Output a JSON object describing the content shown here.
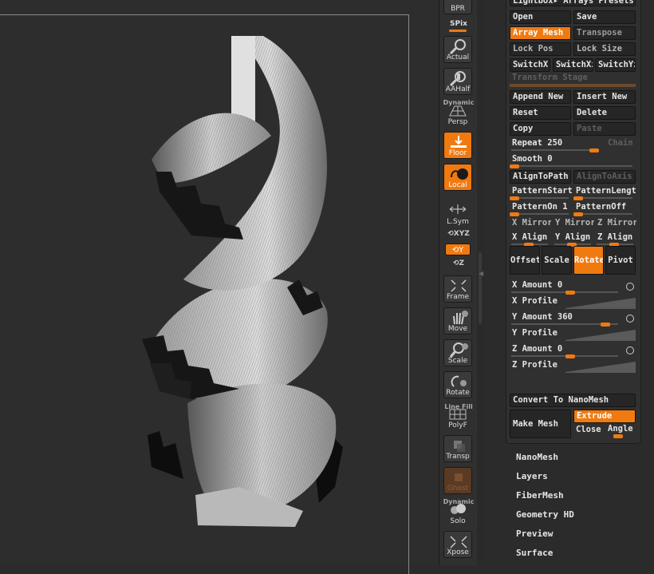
{
  "shelf": {
    "bpr": "BPR",
    "spix": "SPix",
    "actual": "Actual",
    "aahalf": "AAHalf",
    "dynamic1": "Dynamic",
    "persp": "Persp",
    "floor": "Floor",
    "local": "Local",
    "lsym": "L.Sym",
    "xyz": "XYZ",
    "y": "Y",
    "z": "Z",
    "frame": "Frame",
    "move": "Move",
    "scale": "Scale",
    "rotate": "Rotate",
    "linefill": "Line Fill",
    "polyf": "PolyF",
    "transp": "Transp",
    "ghost": "Ghost",
    "dynamic2": "Dynamic",
    "solo": "Solo",
    "xpose": "Xpose"
  },
  "array_mesh": {
    "header": "Lightbox▸ Arrays Presets",
    "open": "Open",
    "save": "Save",
    "array_mesh": "Array Mesh",
    "transpose": "Transpose",
    "lock_pos": "Lock Pos",
    "lock_size": "Lock Size",
    "switch_x": "SwitchX",
    "switch_xz": "SwitchXz",
    "switch_y": "SwitchYz",
    "transform_stage": "Transform Stage",
    "append_new": "Append New",
    "insert_new": "Insert New",
    "reset": "Reset",
    "delete": "Delete",
    "copy": "Copy",
    "paste": "Paste",
    "repeat_label": "Repeat",
    "repeat_value": "250",
    "chain": "Chain",
    "smooth_label": "Smooth",
    "smooth_value": "0",
    "align_to_path": "AlignToPath",
    "align_to_axis": "AlignToAxis",
    "pattern_start": "PatternStart",
    "pattern_length": "PatternLength",
    "pattern_on_label": "PatternOn",
    "pattern_on_value": "1",
    "pattern_off": "PatternOff",
    "x_mirror": "X Mirror",
    "y_mirror": "Y Mirror",
    "z_mirror": "Z Mirror",
    "x_align": "X Align",
    "y_align": "Y Align",
    "z_align": "Z Align",
    "tab_offset": "Offset",
    "tab_scale": "Scale",
    "tab_rotate": "Rotate",
    "tab_pivot": "Pivot",
    "x_amount_label": "X Amount",
    "x_amount_value": "0",
    "x_profile": "X Profile",
    "y_amount_label": "Y Amount",
    "y_amount_value": "360",
    "y_profile": "Y Profile",
    "z_amount_label": "Z Amount",
    "z_amount_value": "0",
    "z_profile": "Z Profile",
    "convert_to_nanomesh": "Convert To NanoMesh",
    "make_mesh": "Make Mesh",
    "extrude": "Extrude",
    "close": "Close",
    "angle": "Angle"
  },
  "subpalettes": [
    "NanoMesh",
    "Layers",
    "FiberMesh",
    "Geometry HD",
    "Preview",
    "Surface"
  ],
  "colors": {
    "accent": "#f07a10",
    "background": "#2b2b2b",
    "button": "#262626"
  }
}
